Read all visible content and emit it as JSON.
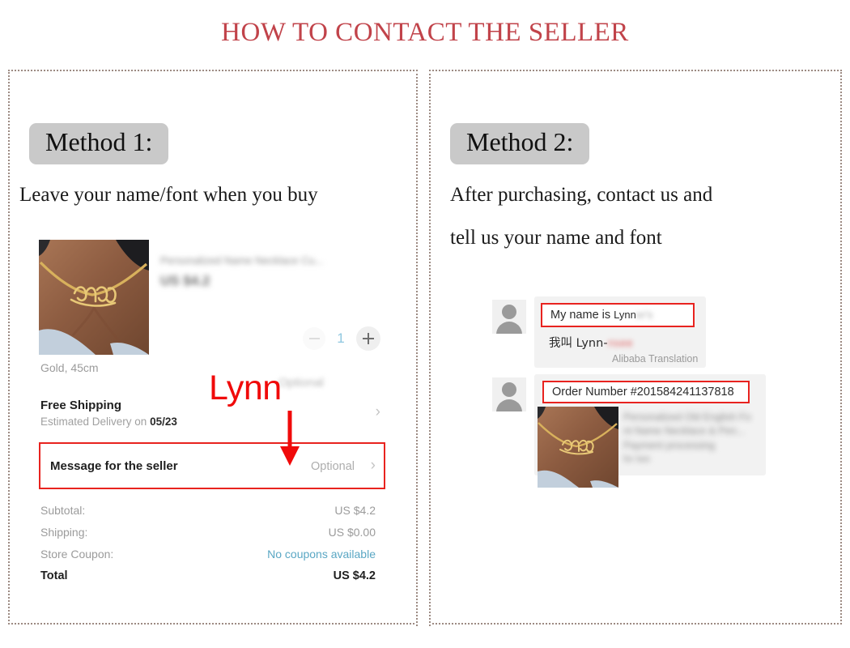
{
  "title": "HOW TO CONTACT THE SELLER",
  "methods": [
    {
      "badge": "Method 1:",
      "description": "Leave your name/font when you buy"
    },
    {
      "badge": "Method 2:",
      "description_line1": "After purchasing, contact us and",
      "description_line2": "tell us your name and font"
    }
  ],
  "order_summary": {
    "product_title_blurred": "Personalized Name Necklace Cu...",
    "product_price_blurred": "US $4.2",
    "necklace_name_engraved": "Gitty",
    "quantity": "1",
    "minus_icon": "minus-icon",
    "plus_icon": "plus-icon",
    "variant": "Gold, 45cm",
    "optional_blurred": "Optional",
    "shipping_title": "Free Shipping",
    "shipping_estimate_prefix": "Estimated Delivery on ",
    "shipping_estimate_date": "05/23",
    "message_row_label": "Message for the seller",
    "message_row_value": "Optional",
    "chevron_icon": "›",
    "totals": [
      {
        "label": "Subtotal:",
        "value": "US $4.2",
        "style": "muted"
      },
      {
        "label": "Shipping:",
        "value": "US $0.00",
        "style": "muted"
      },
      {
        "label": "Store Coupon:",
        "value": "No coupons available",
        "style": "coupon"
      },
      {
        "label": "Total",
        "value": "US $4.2",
        "style": "grand"
      }
    ]
  },
  "annotation": {
    "text": "Lynn",
    "color": "#f00a0a",
    "arrow_icon": "down-arrow-icon",
    "highlight_color": "#e8231f"
  },
  "chat": {
    "avatar_icon": "user-avatar-icon",
    "messages": [
      {
        "highlight_text": "My name is ",
        "highlight_name": "Lynn",
        "highlight_blurred_tail": "er's",
        "translation_line_prefix": "我叫  Lynn-",
        "translation_blurred_tail": "nsee",
        "translation_note": "Alibaba Translation"
      },
      {
        "highlight_text": "Order Number #201584241137818",
        "necklace_name_engraved": "Gitty",
        "card_lines_blurred": [
          "Personalized Old English Fo",
          "nt Name Necklace & Pen...",
          "Payment processing",
          "for two"
        ]
      }
    ]
  }
}
